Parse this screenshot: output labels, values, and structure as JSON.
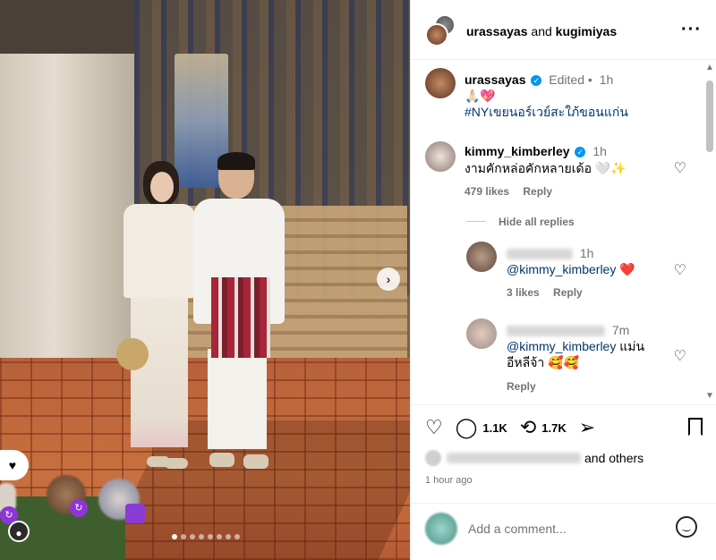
{
  "header": {
    "user1": "urassayas",
    "connector": "and",
    "user2": "kugimiyas",
    "more_icon": "more-icon"
  },
  "caption": {
    "username": "urassayas",
    "edited": "Edited",
    "sep": "•",
    "time": "1h",
    "emojis": "🙏🏻💖",
    "hashtag": "#NYเขยนอร์เวย์สะใภ้ขอนแก่น"
  },
  "comment": {
    "username": "kimmy_kimberley",
    "time": "1h",
    "text": "งามคักหล่อคักหลายเด้อ 🤍✨",
    "likes": "479 likes",
    "reply": "Reply",
    "hide_replies": "Hide all replies"
  },
  "reply1": {
    "time": "1h",
    "mention": "@kimmy_kimberley",
    "emoji": "❤️",
    "likes": "3 likes",
    "reply": "Reply"
  },
  "reply2": {
    "time": "7m",
    "mention": "@kimmy_kimberley",
    "text_after": " แม่น",
    "text_line2": "อีหลีจ้า 🥰🥰",
    "reply": "Reply"
  },
  "actions": {
    "comment_count": "1.1K",
    "repost_count": "1.7K",
    "and_others": "and others",
    "time_ago": "1 hour ago"
  },
  "add_comment": {
    "placeholder": "Add a comment..."
  },
  "carousel": {
    "total_slides": 8,
    "active_slide": 1
  }
}
